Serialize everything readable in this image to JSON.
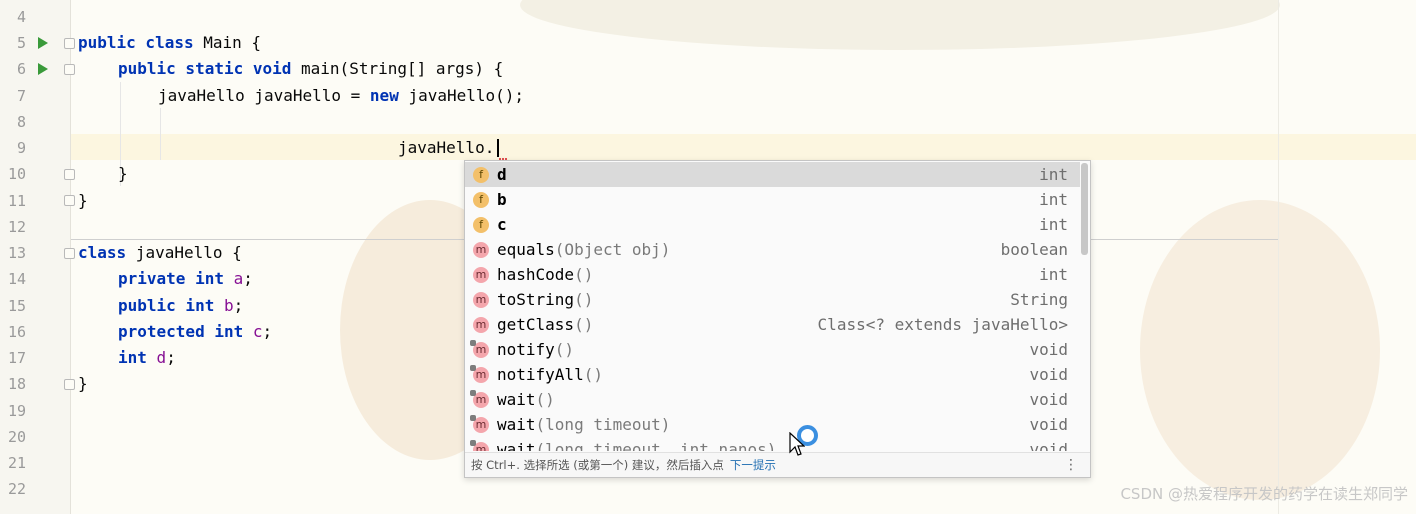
{
  "editor": {
    "line_numbers": [
      "4",
      "5",
      "6",
      "7",
      "8",
      "9",
      "10",
      "11",
      "12",
      "13",
      "14",
      "15",
      "16",
      "17",
      "18",
      "19",
      "20",
      "21",
      "22"
    ],
    "code": {
      "l5": {
        "kw": "public class",
        "rest": " Main {"
      },
      "l6": {
        "kw1": "public static void",
        "rest": " main(String[] args) {"
      },
      "l7": {
        "a": "javaHello javaHello = ",
        "kw": "new",
        "b": " javaHello();"
      },
      "l9": {
        "text": "javaHello."
      },
      "l10": {
        "text": "}"
      },
      "l11": {
        "text": "}"
      },
      "l13": {
        "kw": "class",
        "rest": " javaHello {"
      },
      "l14": {
        "kw": "private int",
        "field": "a",
        "end": ";"
      },
      "l15": {
        "kw": "public int",
        "field": "b",
        "end": ";"
      },
      "l16": {
        "kw": "protected int",
        "field": "c",
        "end": ";"
      },
      "l17": {
        "kw": "int",
        "field": "d",
        "end": ";"
      },
      "l18": {
        "text": "}"
      }
    }
  },
  "completion": {
    "items": [
      {
        "kind": "f",
        "name": "d",
        "params": "",
        "type": "int"
      },
      {
        "kind": "f",
        "name": "b",
        "params": "",
        "type": "int"
      },
      {
        "kind": "f",
        "name": "c",
        "params": "",
        "type": "int"
      },
      {
        "kind": "m",
        "name": "equals",
        "params": "(Object obj)",
        "type": "boolean"
      },
      {
        "kind": "m",
        "name": "hashCode",
        "params": "()",
        "type": "int"
      },
      {
        "kind": "m",
        "name": "toString",
        "params": "()",
        "type": "String"
      },
      {
        "kind": "m",
        "name": "getClass",
        "params": "()",
        "type": "Class<? extends javaHello>"
      },
      {
        "kind": "m",
        "name": "notify",
        "params": "()",
        "type": "void"
      },
      {
        "kind": "m",
        "name": "notifyAll",
        "params": "()",
        "type": "void"
      },
      {
        "kind": "m",
        "name": "wait",
        "params": "()",
        "type": "void"
      },
      {
        "kind": "m",
        "name": "wait",
        "params": "(long timeout)",
        "type": "void"
      },
      {
        "kind": "m",
        "name": "wait",
        "params": "(long timeout, int nanos)",
        "type": "void"
      }
    ],
    "footer_hint": "按 Ctrl+. 选择所选 (或第一个) 建议，然后插入点",
    "footer_next": "下一提示",
    "more_icon": "⋮"
  },
  "watermark": "CSDN @热爱程序开发的药学在读生郑同学",
  "icons": {
    "field": "f",
    "method": "m"
  }
}
